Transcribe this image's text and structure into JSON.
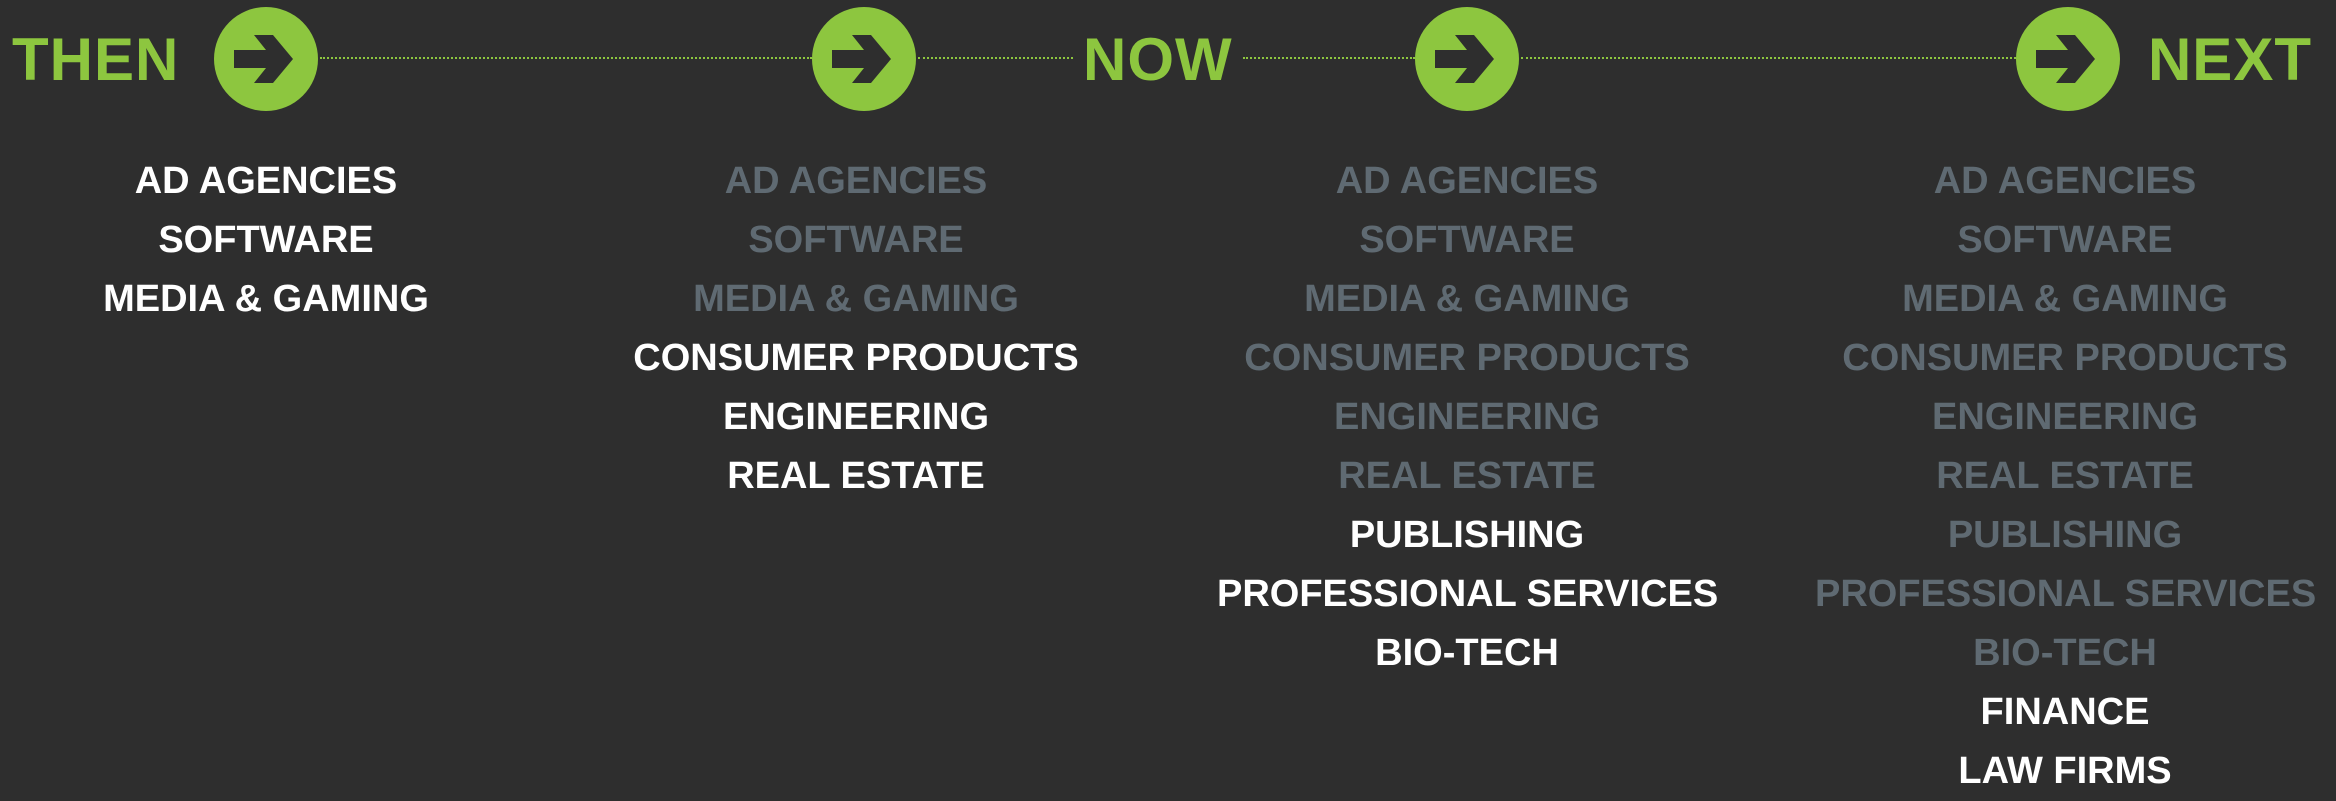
{
  "stages": {
    "then": "THEN",
    "now": "NOW",
    "next": "NEXT"
  },
  "columns": [
    {
      "items": [
        {
          "label": "AD AGENCIES",
          "highlight": true
        },
        {
          "label": "SOFTWARE",
          "highlight": true
        },
        {
          "label": "MEDIA & GAMING",
          "highlight": true
        }
      ]
    },
    {
      "items": [
        {
          "label": "AD AGENCIES",
          "highlight": false
        },
        {
          "label": "SOFTWARE",
          "highlight": false
        },
        {
          "label": "MEDIA & GAMING",
          "highlight": false
        },
        {
          "label": "CONSUMER PRODUCTS",
          "highlight": true
        },
        {
          "label": "ENGINEERING",
          "highlight": true
        },
        {
          "label": "REAL ESTATE",
          "highlight": true
        }
      ]
    },
    {
      "items": [
        {
          "label": "AD AGENCIES",
          "highlight": false
        },
        {
          "label": "SOFTWARE",
          "highlight": false
        },
        {
          "label": "MEDIA & GAMING",
          "highlight": false
        },
        {
          "label": "CONSUMER PRODUCTS",
          "highlight": false
        },
        {
          "label": "ENGINEERING",
          "highlight": false
        },
        {
          "label": "REAL ESTATE",
          "highlight": false
        },
        {
          "label": "PUBLISHING",
          "highlight": true
        },
        {
          "label": "PROFESSIONAL SERVICES",
          "highlight": true
        },
        {
          "label": "BIO-TECH",
          "highlight": true
        }
      ]
    },
    {
      "items": [
        {
          "label": "AD AGENCIES",
          "highlight": false
        },
        {
          "label": "SOFTWARE",
          "highlight": false
        },
        {
          "label": "MEDIA & GAMING",
          "highlight": false
        },
        {
          "label": "CONSUMER PRODUCTS",
          "highlight": false
        },
        {
          "label": "ENGINEERING",
          "highlight": false
        },
        {
          "label": "REAL ESTATE",
          "highlight": false
        },
        {
          "label": "PUBLISHING",
          "highlight": false
        },
        {
          "label": "PROFESSIONAL SERVICES",
          "highlight": false
        },
        {
          "label": "BIO-TECH",
          "highlight": false
        },
        {
          "label": "FINANCE",
          "highlight": true
        },
        {
          "label": "LAW FIRMS",
          "highlight": true
        }
      ]
    }
  ],
  "colors": {
    "accent": "#8dc63f",
    "background": "#2e2e2e",
    "highlight_text": "#ffffff",
    "dim_text": "#5f6a72"
  },
  "icons": {
    "arrow": "arrow-right-circle-icon"
  }
}
